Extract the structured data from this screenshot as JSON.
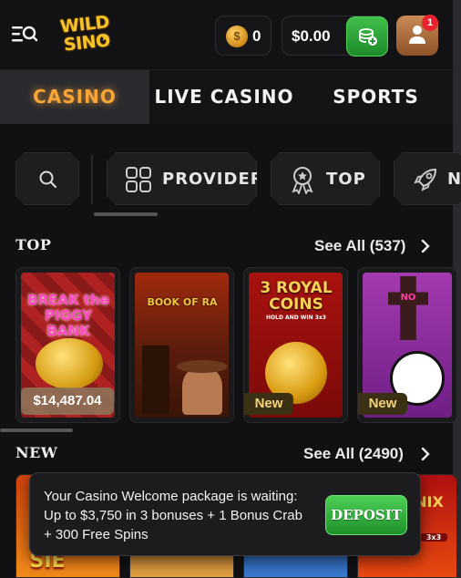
{
  "header": {
    "logo_line1": "WILD",
    "logo_line2": "SINO",
    "coin_symbol": "$",
    "coin_count": "0",
    "balance": "$0.00",
    "notification_count": "1"
  },
  "tabs": [
    {
      "label": "CASINO",
      "active": true
    },
    {
      "label": "LIVE CASINO",
      "active": false
    },
    {
      "label": "SPORTS",
      "active": false
    }
  ],
  "filters": [
    {
      "label": "",
      "icon": "search-icon"
    },
    {
      "label": "PROVIDERS",
      "icon": "grid-icon"
    },
    {
      "label": "TOP",
      "icon": "award-icon"
    },
    {
      "label": "N",
      "icon": "rocket-icon"
    }
  ],
  "sections": {
    "top": {
      "title": "TOP",
      "see_all": "See All (537)",
      "games": [
        {
          "art_text": "BREAK the PIGGY BANK",
          "jackpot": "$14,487.04",
          "new": false
        },
        {
          "art_text": "BOOK OF RA",
          "jackpot": "",
          "new": false
        },
        {
          "art_text": "3 ROYAL COINS",
          "art_sub": "HOLD AND WIN 3x3",
          "jackpot": "",
          "new": true
        },
        {
          "art_text": "NO",
          "jackpot": "",
          "new": true
        }
      ],
      "new_label": "New"
    },
    "new": {
      "title": "NEW",
      "see_all": "See All (2490)",
      "games": [
        {
          "art_text": "SIE"
        },
        {
          "art_text": ""
        },
        {
          "art_text": ""
        },
        {
          "art_text": "NIX",
          "art_sub": "3x3"
        }
      ]
    }
  },
  "toast": {
    "message": "Your Casino Welcome package is waiting: Up to $3,750 in 3 bonuses + 1 Bonus Crab + 300 Free Spins",
    "deposit_label": "DEPOSIT"
  },
  "colors": {
    "accent": "#f7a637",
    "green": "#2fae3a",
    "background": "#111113"
  }
}
